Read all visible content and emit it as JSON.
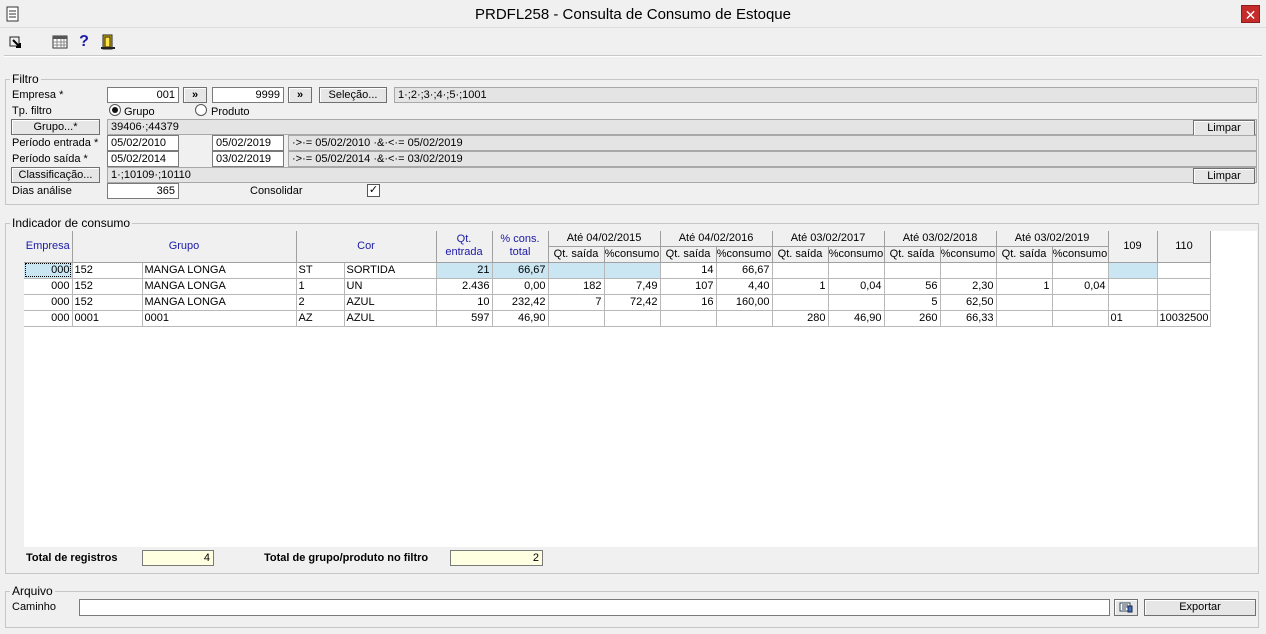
{
  "window": {
    "title": "PRDFL258 - Consulta de Consumo de Estoque",
    "close_glyph": "✕"
  },
  "toolbar": {
    "icons": [
      "exit-arrow-icon",
      "calendar-grid-icon",
      "help-icon",
      "door-exit-icon"
    ],
    "help_glyph": "?"
  },
  "filtro": {
    "legend": "Filtro",
    "empresa_label": "Empresa *",
    "empresa_from": "001",
    "empresa_to": "9999",
    "jump_glyph": "»",
    "selecao_label": "Seleção...",
    "selecao_value": "1·;2·;3·;4·;5·;1001",
    "tp_filtro_label": "Tp. filtro",
    "radio_grupo": "Grupo",
    "radio_produto": "Produto",
    "grupo_button": "Grupo...*",
    "grupo_value": "39406·;44379",
    "limpar_label": "Limpar",
    "periodo_entrada_label": "Período entrada *",
    "periodo_entrada_from": "05/02/2010",
    "periodo_entrada_to": "05/02/2019",
    "periodo_entrada_expr": "·>·= 05/02/2010 ·&·<·= 05/02/2019",
    "periodo_saida_label": "Período saída *",
    "periodo_saida_from": "05/02/2014",
    "periodo_saida_to": "03/02/2019",
    "periodo_saida_expr": "·>·= 05/02/2014 ·&·<·= 03/02/2019",
    "classificacao_button": "Classificação...",
    "classificacao_value": "1·;10109·;10110",
    "dias_analise_label": "Dias análise",
    "dias_analise_value": "365",
    "consolidar_label": "Consolidar",
    "consolidar_checked": true,
    "check_glyph": "✓"
  },
  "indicador": {
    "legend": "Indicador de consumo",
    "headers": {
      "empresa": "Empresa",
      "grupo": "Grupo",
      "cor": "Cor",
      "qt_entrada_1": "Qt.",
      "qt_entrada_2": "entrada",
      "cons_total_1": "% cons.",
      "cons_total_2": "total",
      "periods": [
        "Até 04/02/2015",
        "Até 04/02/2016",
        "Até 03/02/2017",
        "Até 03/02/2018",
        "Até 03/02/2019"
      ],
      "qt_saida": "Qt. saída",
      "pct_consumo": "%consumo",
      "col_109": "109",
      "col_110": "110"
    },
    "rows": [
      [
        "000",
        "152",
        "MANGA LONGA",
        "ST",
        "SORTIDA",
        "21",
        "66,67",
        "",
        "",
        "14",
        "66,67",
        "",
        "",
        "",
        "",
        "",
        "",
        "",
        ""
      ],
      [
        "000",
        "152",
        "MANGA LONGA",
        "1",
        "UN",
        "2.436",
        "0,00",
        "182",
        "7,49",
        "107",
        "4,40",
        "1",
        "0,04",
        "56",
        "2,30",
        "1",
        "0,04",
        "",
        ""
      ],
      [
        "000",
        "152",
        "MANGA LONGA",
        "2",
        "AZUL",
        "10",
        "232,42",
        "7",
        "72,42",
        "16",
        "160,00",
        "",
        "",
        "5",
        "62,50",
        "",
        "",
        "",
        ""
      ],
      [
        "000",
        "0001",
        "0001",
        "AZ",
        "AZUL",
        "597",
        "46,90",
        "",
        "",
        "",
        "",
        "280",
        "46,90",
        "260",
        "66,33",
        "",
        "",
        "01",
        "10032500"
      ]
    ],
    "total_registros_label": "Total de registros",
    "total_registros_value": "4",
    "total_grupo_label": "Total de grupo/produto no filtro",
    "total_grupo_value": "2"
  },
  "arquivo": {
    "legend": "Arquivo",
    "caminho_label": "Caminho",
    "caminho_value": "",
    "exportar_label": "Exportar"
  }
}
